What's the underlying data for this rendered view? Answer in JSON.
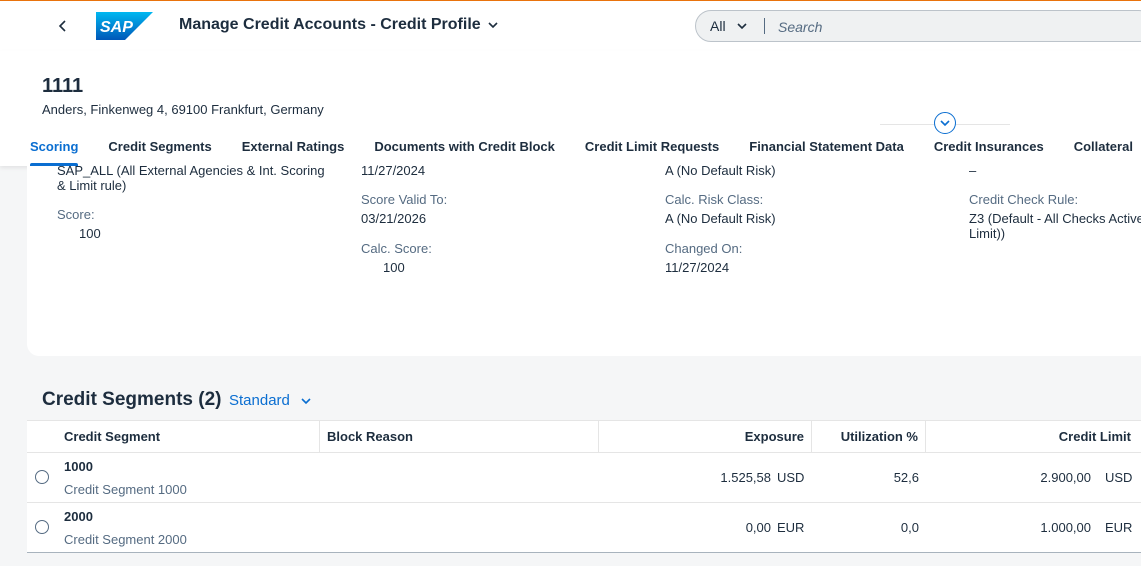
{
  "shell": {
    "app_title": "Manage Credit Accounts - Credit Profile",
    "search_scope": "All",
    "search_placeholder": "Search",
    "logo_text": "SAP"
  },
  "header": {
    "title": "1111",
    "subtitle": "Anders, Finkenweg 4, 69100 Frankfurt, Germany"
  },
  "tabs": [
    {
      "label": "Scoring",
      "active": true
    },
    {
      "label": "Credit Segments"
    },
    {
      "label": "External Ratings"
    },
    {
      "label": "Documents with Credit Block"
    },
    {
      "label": "Credit Limit Requests"
    },
    {
      "label": "Financial Statement Data"
    },
    {
      "label": "Credit Insurances"
    },
    {
      "label": "Collateral"
    }
  ],
  "scoring": {
    "rule_value": "SAP_ALL (All External Agencies & Int. Scoring & Limit rule)",
    "score_label": "Score:",
    "score_value": "100",
    "valid_from_value": "11/27/2024",
    "valid_to_label": "Score Valid To:",
    "valid_to_value": "03/21/2026",
    "calc_score_label": "Calc. Score:",
    "calc_score_value": "100",
    "risk_class_value": "A (No Default Risk)",
    "calc_risk_label": "Calc. Risk Class:",
    "calc_risk_value": "A (No Default Risk)",
    "changed_on_label": "Changed On:",
    "changed_on_value": "11/27/2024",
    "top_right_value": "–",
    "check_rule_label": "Credit Check Rule:",
    "check_rule_value": "Z3 (Default - All Checks Active Limit))"
  },
  "segments": {
    "title": "Credit Segments (2)",
    "variant": "Standard",
    "columns": {
      "segment": "Credit Segment",
      "block_reason": "Block Reason",
      "exposure": "Exposure",
      "utilization": "Utilization %",
      "limit": "Credit Limit"
    },
    "rows": [
      {
        "id": "1000",
        "desc": "Credit Segment 1000",
        "block": "",
        "exposure": "1.525,58",
        "exposure_cur": "USD",
        "utilization": "52,6",
        "limit": "2.900,00",
        "limit_cur": "USD"
      },
      {
        "id": "2000",
        "desc": "Credit Segment 2000",
        "block": "",
        "exposure": "0,00",
        "exposure_cur": "EUR",
        "utilization": "0,0",
        "limit": "1.000,00",
        "limit_cur": "EUR"
      }
    ]
  },
  "colors": {
    "accent": "#0a6ed1",
    "brand_top_line": "#e9730c",
    "text": "#1d2d3e",
    "label": "#556b82"
  }
}
